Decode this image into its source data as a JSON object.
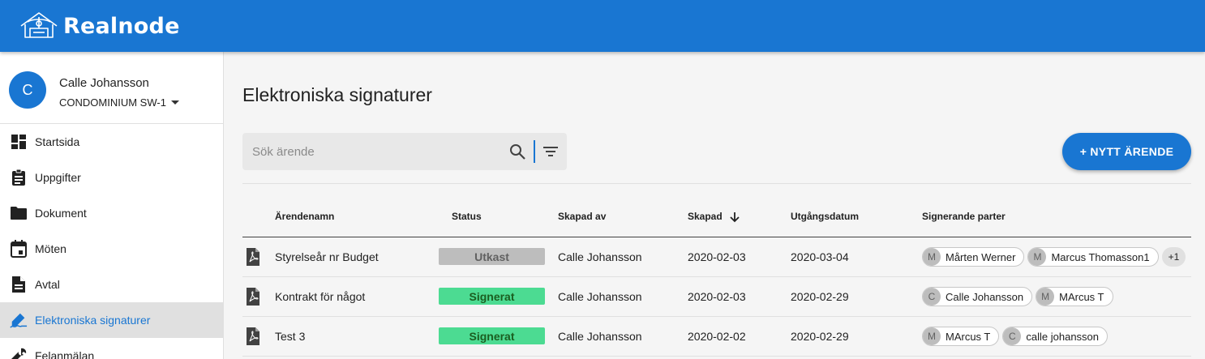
{
  "app": {
    "brand": "Realnode"
  },
  "sidebar": {
    "user": {
      "initial": "C",
      "name": "Calle Johansson",
      "org": "CONDOMINIUM SW-1"
    },
    "items": [
      {
        "label": "Startsida",
        "icon": "dashboard-icon"
      },
      {
        "label": "Uppgifter",
        "icon": "assignment-icon"
      },
      {
        "label": "Dokument",
        "icon": "folder-icon"
      },
      {
        "label": "Möten",
        "icon": "calendar-icon"
      },
      {
        "label": "Avtal",
        "icon": "document-icon"
      },
      {
        "label": "Elektroniska signaturer",
        "icon": "signature-icon",
        "active": true
      },
      {
        "label": "Felanmälan",
        "icon": "wrench-icon"
      }
    ]
  },
  "main": {
    "title": "Elektroniska signaturer",
    "search": {
      "placeholder": "Sök ärende",
      "value": ""
    },
    "new_button": "+ NYTT ÄRENDE",
    "columns": {
      "name": "Ärendenamn",
      "status": "Status",
      "created_by": "Skapad av",
      "created": "Skapad",
      "expires": "Utgångsdatum",
      "parties": "Signerande parter"
    },
    "rows": [
      {
        "name": "Styrelseår nr Budget",
        "status": "Utkast",
        "created_by": "Calle Johansson",
        "created": "2020-02-03",
        "expires": "2020-03-04",
        "parties": [
          {
            "initial": "M",
            "name": "Mårten Werner"
          },
          {
            "initial": "M",
            "name": "Marcus Thomasson1"
          }
        ],
        "more": "+1"
      },
      {
        "name": "Kontrakt för något",
        "status": "Signerat",
        "created_by": "Calle Johansson",
        "created": "2020-02-03",
        "expires": "2020-02-29",
        "parties": [
          {
            "initial": "C",
            "name": "Calle Johansson"
          },
          {
            "initial": "M",
            "name": "MArcus T"
          }
        ]
      },
      {
        "name": "Test 3",
        "status": "Signerat",
        "created_by": "Calle Johansson",
        "created": "2020-02-02",
        "expires": "2020-02-29",
        "parties": [
          {
            "initial": "M",
            "name": "MArcus T"
          },
          {
            "initial": "C",
            "name": "calle johansson"
          }
        ]
      }
    ]
  },
  "colors": {
    "primary": "#1976d2",
    "status_draft": "#bdbdbd",
    "status_signed": "#4cdb92"
  }
}
